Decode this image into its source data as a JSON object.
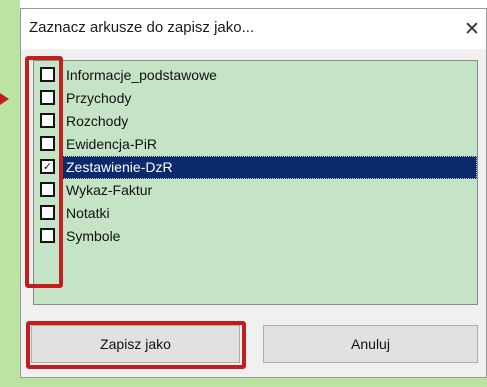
{
  "dialog": {
    "title": "Zaznacz arkusze do zapisz jako...",
    "close_glyph": "✕"
  },
  "sheets": [
    {
      "label": "Informacje_podstawowe",
      "checked": false,
      "selected": false
    },
    {
      "label": "Przychody",
      "checked": false,
      "selected": false
    },
    {
      "label": "Rozchody",
      "checked": false,
      "selected": false
    },
    {
      "label": "Ewidencja-PiR",
      "checked": false,
      "selected": false
    },
    {
      "label": "Zestawienie-DzR",
      "checked": true,
      "selected": true
    },
    {
      "label": "Wykaz-Faktur",
      "checked": false,
      "selected": false
    },
    {
      "label": "Notatki",
      "checked": false,
      "selected": false
    },
    {
      "label": "Symbole",
      "checked": false,
      "selected": false
    }
  ],
  "buttons": {
    "save_label": "Zapisz jako",
    "cancel_label": "Anuluj"
  },
  "colors": {
    "selection": "#0b2a6e",
    "list_background": "#c5e4c5",
    "highlight": "#c11f1f",
    "page_accent": "#bde3a3"
  },
  "icons": {
    "close": "close-icon",
    "checkmark": "checkmark-icon",
    "arrow": "arrow-right-icon"
  }
}
